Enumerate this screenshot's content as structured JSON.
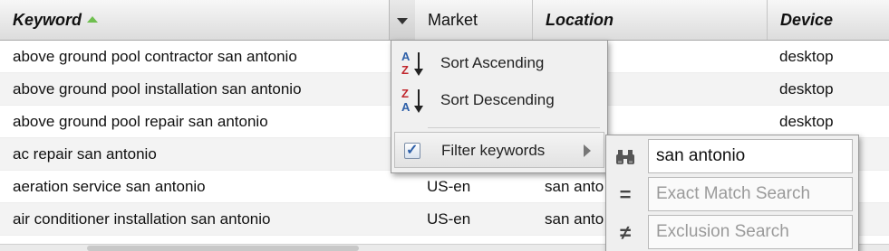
{
  "grid": {
    "columns": [
      {
        "label": "Keyword",
        "bold": true,
        "sorted": "ascending"
      },
      {
        "label": "Market",
        "bold": false
      },
      {
        "label": "Location",
        "bold": true
      },
      {
        "label": "Device",
        "bold": true
      }
    ],
    "rows": [
      {
        "keyword": "above ground pool contractor san antonio",
        "market": "",
        "location": "onio",
        "device": "desktop"
      },
      {
        "keyword": "above ground pool installation san antonio",
        "market": "",
        "location": "onio",
        "device": "desktop"
      },
      {
        "keyword": "above ground pool repair san antonio",
        "market": "",
        "location": "onio",
        "device": "desktop"
      },
      {
        "keyword": "ac repair san antonio",
        "market": "",
        "location": "",
        "device": ""
      },
      {
        "keyword": "aeration service san antonio",
        "market": "US-en",
        "location": "san anto",
        "device": ""
      },
      {
        "keyword": "air conditioner installation san antonio",
        "market": "US-en",
        "location": "san anto",
        "device": ""
      }
    ]
  },
  "column_menu": {
    "sort_ascending": "Sort Ascending",
    "sort_descending": "Sort Descending",
    "filter": "Filter keywords",
    "filter_checked": true
  },
  "filter_submenu": {
    "contains_value": "san antonio",
    "exact_placeholder": "Exact Match Search",
    "exclusion_placeholder": "Exclusion Search",
    "icons": [
      "binoculars-icon",
      "equals-icon",
      "not-equal-icon"
    ]
  },
  "colors": {
    "sort_arrow": "#6fbf4f",
    "sort_icon_letter_a": "#2d5fa8",
    "sort_icon_letter_z": "#c0262c"
  }
}
